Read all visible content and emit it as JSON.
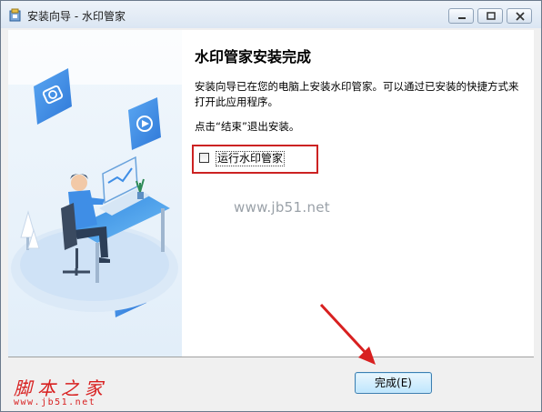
{
  "window": {
    "title": "安装向导 - 水印管家",
    "controls": [
      "minimize-icon",
      "maximize-icon",
      "close-icon"
    ]
  },
  "page": {
    "heading": "水印管家安装完成",
    "description": "安装向导已在您的电脑上安装水印管家。可以通过已安装的快捷方式来打开此应用程序。",
    "hint": "点击“结束”退出安装。",
    "run_checkbox": {
      "label": "运行水印管家",
      "checked": false
    }
  },
  "watermark": "www.jb51.net",
  "footer": {
    "finish_label": "完成(E)"
  },
  "site_logo": {
    "main": "脚本之家",
    "sub": "www.jb51.net"
  },
  "colors": {
    "annotation_red": "#cc2222",
    "illustration_blue": "#3f8ee6",
    "logo_red": "#d82020"
  }
}
